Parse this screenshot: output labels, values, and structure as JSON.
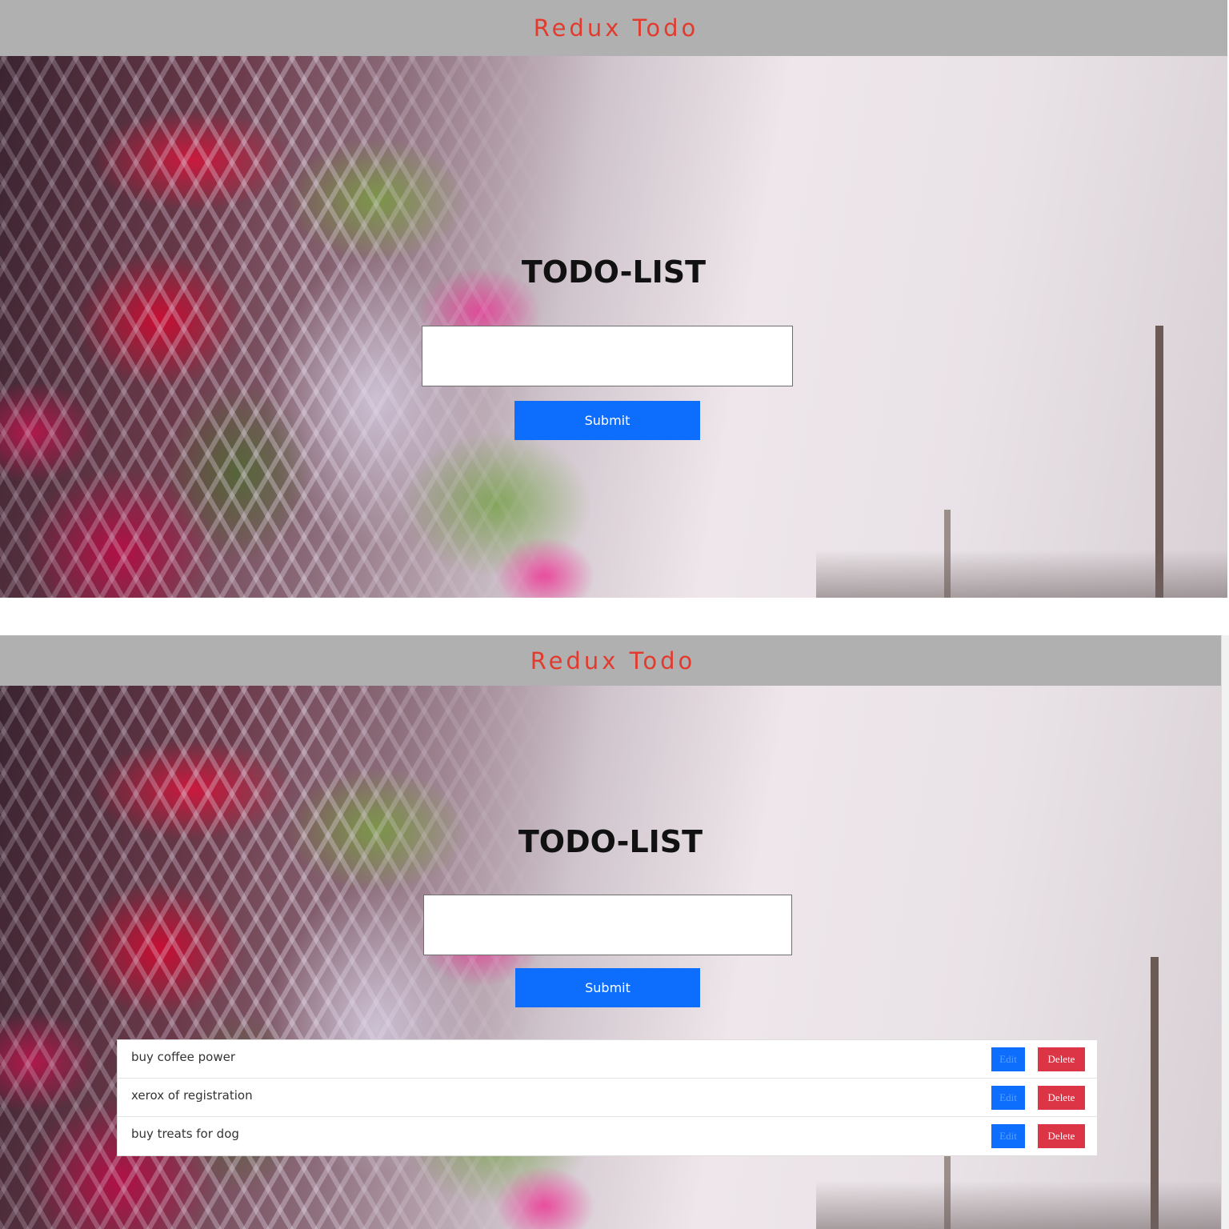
{
  "screen1": {
    "header": {
      "title": "Redux Todo"
    },
    "main": {
      "heading": "TODO-LIST",
      "input": {
        "value": "",
        "placeholder": ""
      },
      "submit_label": "Submit"
    }
  },
  "screen2": {
    "header": {
      "title": "Redux Todo"
    },
    "main": {
      "heading": "TODO-LIST",
      "input": {
        "value": "",
        "placeholder": ""
      },
      "submit_label": "Submit"
    },
    "todos": [
      {
        "text": "buy coffee power",
        "edit_label": "Edit",
        "delete_label": "Delete"
      },
      {
        "text": "xerox of registration",
        "edit_label": "Edit",
        "delete_label": "Delete"
      },
      {
        "text": "buy treats for dog",
        "edit_label": "Edit",
        "delete_label": "Delete"
      }
    ]
  },
  "colors": {
    "header_bg": "#b0b0b0",
    "header_text": "#e23b2e",
    "submit_bg": "#0d6efd",
    "edit_bg": "#0d6efd",
    "delete_bg": "#dc3545"
  }
}
